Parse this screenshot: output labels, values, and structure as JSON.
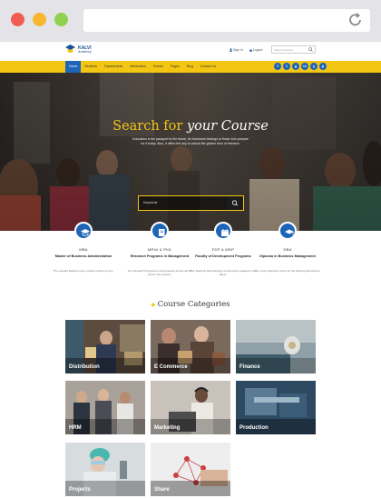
{
  "site": {
    "logo_name": "KALVI",
    "logo_sub": "Academy",
    "top_links": [
      "Sign in",
      "Logout"
    ],
    "search_placeholder": "Search courses"
  },
  "nav": {
    "items": [
      "Home",
      "Students",
      "Departments",
      "Admissions",
      "Events",
      "Pages",
      "Blog",
      "Contact Us"
    ],
    "active": "Home",
    "socials": [
      "f",
      "t",
      "g",
      "in",
      "y",
      "p"
    ]
  },
  "hero": {
    "title_prefix": "Search for",
    "title_emphasis": "your Course",
    "subtitle": "Education is the passport to the future, for tomorrow belongs to those who prepare for it today. Also, it offers the key to unlock the golden door of freedom.",
    "search_placeholder": "Keywords"
  },
  "programs": [
    {
      "code": "MBA",
      "name": "Master of Business Administration",
      "desc": "The coveted Masters every student desires to join.",
      "icon": "graduation-icon"
    },
    {
      "code": "MPhil & PhD",
      "name": "Research Programs in Management",
      "desc": "The Research Programs encompassed across all the land in the industry.",
      "icon": "book-icon"
    },
    {
      "code": "FDP & MDP",
      "name": "Faculty of Development Programs",
      "desc": "The Teaching Methodology continuously updated to the latest.",
      "icon": "calendar-icon"
    },
    {
      "code": "DBA",
      "name": "Diploma in Business Management",
      "desc": "The most preferred choice for the Working Executives.",
      "icon": "mortarboard-icon"
    }
  ],
  "categories_title": "Course Categories",
  "categories": [
    "Distribution",
    "E Commerce",
    "Finance",
    "HRM",
    "Marketing",
    "Production",
    "Projects",
    "Share"
  ],
  "colors": {
    "accent_yellow": "#f3c613",
    "brand_blue": "#1e64b7"
  }
}
